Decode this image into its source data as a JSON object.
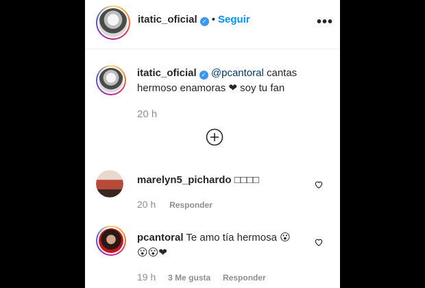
{
  "header": {
    "username": "itatic_oficial",
    "verified_mark": "✓",
    "separator": "•",
    "follow_label": "Seguir",
    "more_label": "•••"
  },
  "caption": {
    "username": "itatic_oficial",
    "mention": "@pcantoral",
    "text_line1": " cantas",
    "text_line2": "hermoso enamoras ❤ soy tu fan",
    "time": "20 h"
  },
  "load_more_icon": "plus-circle-icon",
  "comments": [
    {
      "username": "marelyn5_pichardo",
      "text": "□□□□",
      "time": "20 h",
      "reply_label": "Responder"
    },
    {
      "username": "pcantoral",
      "text_line1": "Te amo tía hermosa 😮",
      "text_line2": "😮😮❤",
      "time": "19 h",
      "likes_label": "3 Me gusta",
      "reply_label": "Responder"
    }
  ]
}
